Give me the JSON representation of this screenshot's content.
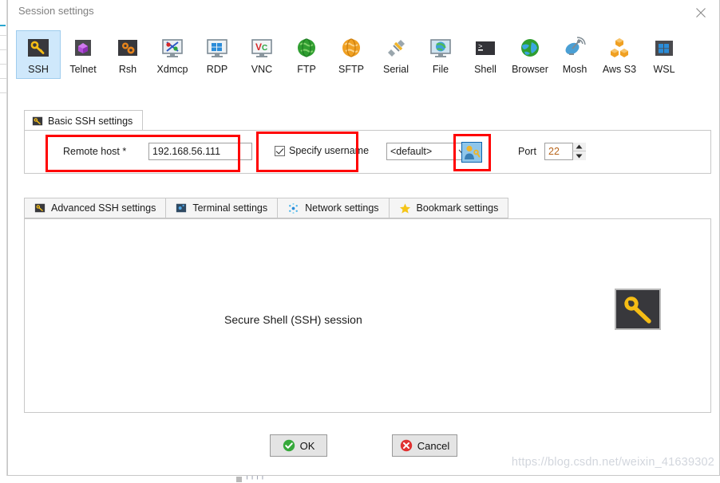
{
  "window": {
    "title": "Session settings",
    "close_label": "×",
    "close_icon": "close-icon"
  },
  "session_toolbar": {
    "items": [
      {
        "label": "SSH",
        "icon": "ssh-key-icon",
        "selected": true
      },
      {
        "label": "Telnet",
        "icon": "telnet-icon",
        "selected": false
      },
      {
        "label": "Rsh",
        "icon": "rsh-gears-icon",
        "selected": false
      },
      {
        "label": "Xdmcp",
        "icon": "xdmcp-monitor-icon",
        "selected": false
      },
      {
        "label": "RDP",
        "icon": "rdp-monitor-icon",
        "selected": false
      },
      {
        "label": "VNC",
        "icon": "vnc-monitor-icon",
        "selected": false
      },
      {
        "label": "FTP",
        "icon": "ftp-globe-icon",
        "selected": false
      },
      {
        "label": "SFTP",
        "icon": "sftp-globe-icon",
        "selected": false
      },
      {
        "label": "Serial",
        "icon": "serial-plug-icon",
        "selected": false
      },
      {
        "label": "File",
        "icon": "file-monitor-icon",
        "selected": false
      },
      {
        "label": "Shell",
        "icon": "shell-terminal-icon",
        "selected": false
      },
      {
        "label": "Browser",
        "icon": "browser-globe-icon",
        "selected": false
      },
      {
        "label": "Mosh",
        "icon": "mosh-dish-icon",
        "selected": false
      },
      {
        "label": "Aws S3",
        "icon": "aws-s3-icon",
        "selected": false
      },
      {
        "label": "WSL",
        "icon": "wsl-windows-icon",
        "selected": false
      }
    ]
  },
  "basic_settings": {
    "tab_label": "Basic SSH settings",
    "tab_icon": "key-icon",
    "remote_host_label": "Remote host *",
    "remote_host_value": "192.168.56.111",
    "remote_host_placeholder": "",
    "specify_username_label": "Specify username",
    "specify_username_checked": true,
    "username_value": "<default>",
    "username_dropdown_icon": "chevron-down-icon",
    "user_key_button_icon": "user-key-icon",
    "port_label": "Port",
    "port_value": "22",
    "port_spinner_icon": "spinner-updown-icon"
  },
  "lower_tabs": [
    {
      "label": "Advanced SSH settings",
      "icon": "key-icon",
      "active": false
    },
    {
      "label": "Terminal settings",
      "icon": "terminal-icon",
      "active": false
    },
    {
      "label": "Network settings",
      "icon": "network-icon",
      "active": false
    },
    {
      "label": "Bookmark settings",
      "icon": "star-icon",
      "active": false
    }
  ],
  "content": {
    "description": "Secure Shell (SSH) session",
    "big_icon": "ssh-key-icon"
  },
  "buttons": {
    "ok_label": "OK",
    "ok_icon": "check-circle-icon",
    "cancel_label": "Cancel",
    "cancel_icon": "x-circle-icon"
  },
  "watermark": {
    "text": "https://blog.csdn.net/weixin_41639302"
  },
  "colors": {
    "selection_blue": "#cfe8fb",
    "annotation_red": "#ff0000",
    "ok_green": "#36a93b",
    "cancel_red": "#e03131",
    "key_gold": "#f5bd15",
    "port_text": "#b8651b"
  }
}
